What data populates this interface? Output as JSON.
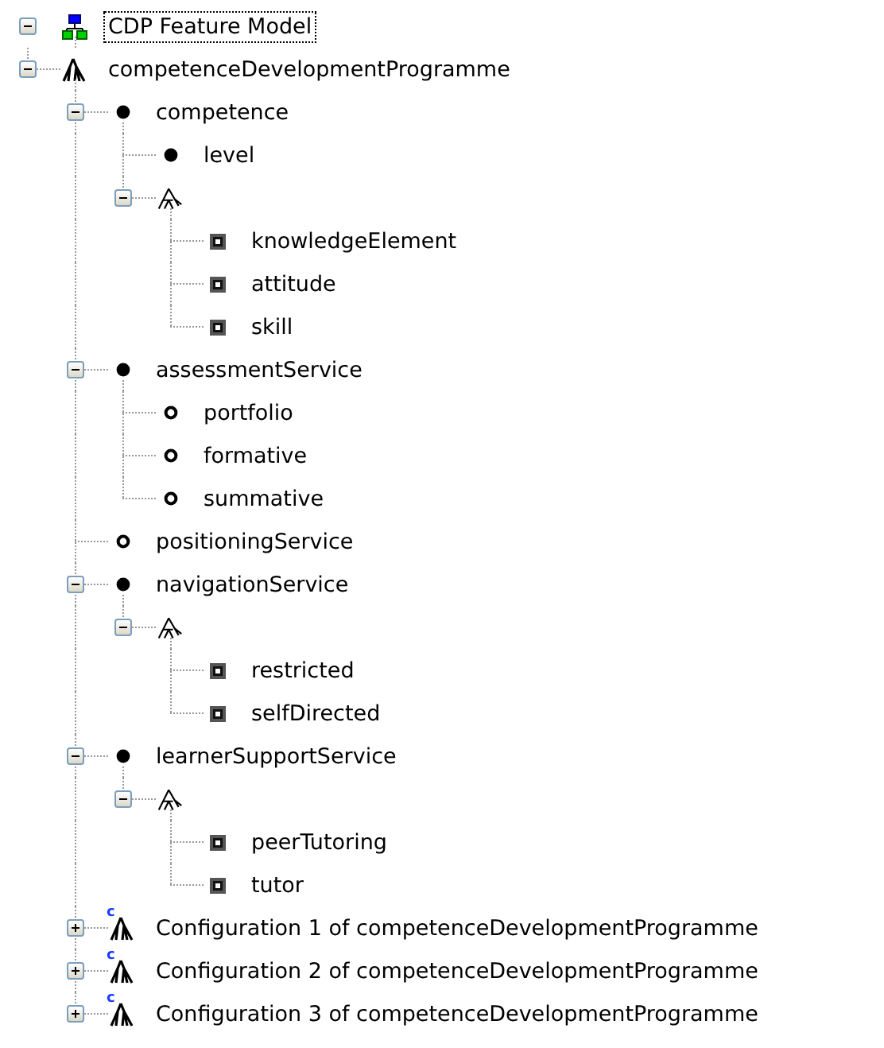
{
  "tree": {
    "kind": "model",
    "label": "CDP Feature Model",
    "selected": true,
    "expanded": true,
    "children": [
      {
        "kind": "concept",
        "label": "competenceDevelopmentProgramme",
        "selected": false,
        "expanded": true,
        "children": [
          {
            "kind": "mandatory",
            "label": "competence",
            "selected": false,
            "expanded": true,
            "children": [
              {
                "kind": "mandatory",
                "label": "level",
                "selected": false
              },
              {
                "kind": "group",
                "expanded": true,
                "children": [
                  {
                    "kind": "grouped",
                    "label": "knowledgeElement",
                    "selected": false
                  },
                  {
                    "kind": "grouped",
                    "label": "attitude",
                    "selected": false
                  },
                  {
                    "kind": "grouped",
                    "label": "skill",
                    "selected": false
                  }
                ]
              }
            ]
          },
          {
            "kind": "mandatory",
            "label": "assessmentService",
            "selected": false,
            "expanded": true,
            "children": [
              {
                "kind": "optional",
                "label": "portfolio",
                "selected": false
              },
              {
                "kind": "optional",
                "label": "formative",
                "selected": false
              },
              {
                "kind": "optional",
                "label": "summative",
                "selected": false
              }
            ]
          },
          {
            "kind": "optional",
            "label": "positioningService",
            "selected": false
          },
          {
            "kind": "mandatory",
            "label": "navigationService",
            "selected": false,
            "expanded": true,
            "children": [
              {
                "kind": "group",
                "expanded": true,
                "children": [
                  {
                    "kind": "grouped",
                    "label": "restricted",
                    "selected": false
                  },
                  {
                    "kind": "grouped",
                    "label": "selfDirected",
                    "selected": false
                  }
                ]
              }
            ]
          },
          {
            "kind": "mandatory",
            "label": "learnerSupportService",
            "selected": false,
            "expanded": true,
            "children": [
              {
                "kind": "group",
                "expanded": true,
                "children": [
                  {
                    "kind": "grouped",
                    "label": "peerTutoring",
                    "selected": false
                  },
                  {
                    "kind": "grouped",
                    "label": "tutor",
                    "selected": false
                  }
                ]
              }
            ]
          },
          {
            "kind": "configuration",
            "badge": "c",
            "label": "Configuration 1 of competenceDevelopmentProgramme",
            "selected": false,
            "expanded": false
          },
          {
            "kind": "configuration",
            "badge": "c",
            "label": "Configuration 2 of competenceDevelopmentProgramme",
            "selected": false,
            "expanded": false
          },
          {
            "kind": "configuration",
            "badge": "c",
            "label": "Configuration 3 of competenceDevelopmentProgramme",
            "selected": false,
            "expanded": false
          }
        ]
      }
    ]
  }
}
